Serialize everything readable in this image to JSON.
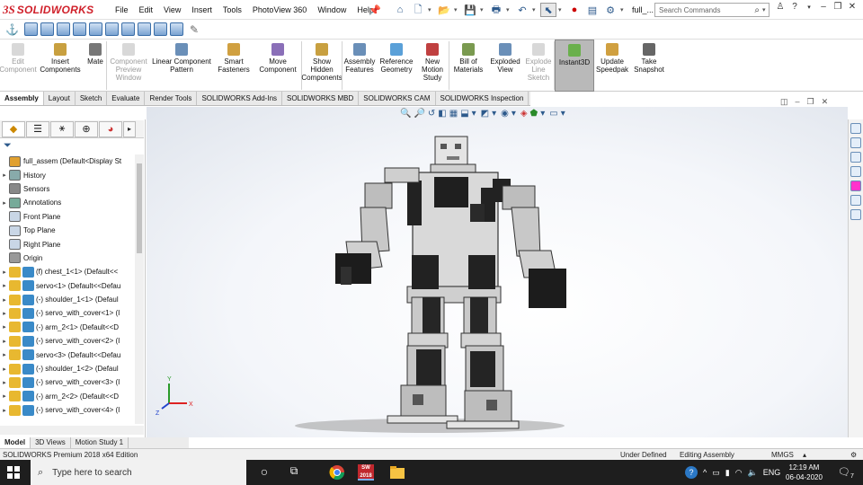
{
  "app": {
    "logo_ds": "3S",
    "logo_text": "SOLIDWORKS",
    "menu": [
      "File",
      "Edit",
      "View",
      "Insert",
      "Tools",
      "PhotoView 360",
      "Window",
      "Help"
    ],
    "doc_name": "full_...",
    "search_placeholder": "Search Commands",
    "help_glyph": "?"
  },
  "command_manager": [
    {
      "label": "Edit Component",
      "icon": "edit-component-icon",
      "enabled": false,
      "active": false
    },
    {
      "label": "Insert Components",
      "icon": "insert-components-icon",
      "enabled": true,
      "active": false
    },
    {
      "label": "Mate",
      "icon": "mate-icon",
      "enabled": true,
      "active": false
    },
    {
      "label": "Component Preview Window",
      "icon": "component-preview-icon",
      "enabled": false,
      "active": false
    },
    {
      "label": "Linear Component Pattern",
      "icon": "linear-pattern-icon",
      "enabled": true,
      "active": false
    },
    {
      "label": "Smart Fasteners",
      "icon": "smart-fasteners-icon",
      "enabled": true,
      "active": false
    },
    {
      "label": "Move Component",
      "icon": "move-component-icon",
      "enabled": true,
      "active": false
    },
    {
      "label": "Show Hidden Components",
      "icon": "show-hidden-icon",
      "enabled": true,
      "active": false
    },
    {
      "label": "Assembly Features",
      "icon": "assembly-features-icon",
      "enabled": true,
      "active": false
    },
    {
      "label": "Reference Geometry",
      "icon": "reference-geometry-icon",
      "enabled": true,
      "active": false
    },
    {
      "label": "New Motion Study",
      "icon": "motion-study-icon",
      "enabled": true,
      "active": false
    },
    {
      "label": "Bill of Materials",
      "icon": "bom-icon",
      "enabled": true,
      "active": false
    },
    {
      "label": "Exploded View",
      "icon": "exploded-view-icon",
      "enabled": true,
      "active": false
    },
    {
      "label": "Explode Line Sketch",
      "icon": "explode-line-icon",
      "enabled": false,
      "active": false
    },
    {
      "label": "Instant3D",
      "icon": "instant3d-icon",
      "enabled": true,
      "active": true
    },
    {
      "label": "Update Speedpak",
      "icon": "speedpak-icon",
      "enabled": true,
      "active": false
    },
    {
      "label": "Take Snapshot",
      "icon": "snapshot-icon",
      "enabled": true,
      "active": false
    }
  ],
  "tabs": [
    "Assembly",
    "Layout",
    "Sketch",
    "Evaluate",
    "Render Tools",
    "SOLIDWORKS Add-Ins",
    "SOLIDWORKS MBD",
    "SOLIDWORKS CAM",
    "SOLIDWORKS Inspection"
  ],
  "active_tab": "Assembly",
  "tree": [
    {
      "label": "full_assem  (Default<Display St",
      "icon": "assembly-icon",
      "arrow": ""
    },
    {
      "label": "History",
      "icon": "history-icon",
      "arrow": "▸"
    },
    {
      "label": "Sensors",
      "icon": "sensors-icon",
      "arrow": ""
    },
    {
      "label": "Annotations",
      "icon": "annotations-icon",
      "arrow": "▸"
    },
    {
      "label": "Front Plane",
      "icon": "plane-icon",
      "arrow": ""
    },
    {
      "label": "Top Plane",
      "icon": "plane-icon",
      "arrow": ""
    },
    {
      "label": "Right Plane",
      "icon": "plane-icon",
      "arrow": ""
    },
    {
      "label": "Origin",
      "icon": "origin-icon",
      "arrow": ""
    },
    {
      "label": "(f) chest_1<1> (Default<<",
      "icon": "part-icon",
      "arrow": "▸"
    },
    {
      "label": "servo<1> (Default<<Defau",
      "icon": "part-icon",
      "arrow": "▸"
    },
    {
      "label": "(-) shoulder_1<1> (Defaul",
      "icon": "part-icon",
      "arrow": "▸"
    },
    {
      "label": "(-) servo_with_cover<1> (I",
      "icon": "part-icon",
      "arrow": "▸"
    },
    {
      "label": "(-) arm_2<1> (Default<<D",
      "icon": "part-icon",
      "arrow": "▸"
    },
    {
      "label": "(-) servo_with_cover<2> (I",
      "icon": "part-icon",
      "arrow": "▸"
    },
    {
      "label": "servo<3> (Default<<Defau",
      "icon": "part-icon",
      "arrow": "▸"
    },
    {
      "label": "(-) shoulder_1<2> (Defaul",
      "icon": "part-icon",
      "arrow": "▸"
    },
    {
      "label": "(-) servo_with_cover<3> (I",
      "icon": "part-icon",
      "arrow": "▸"
    },
    {
      "label": "(-) arm_2<2> (Default<<D",
      "icon": "part-icon",
      "arrow": "▸"
    },
    {
      "label": "(-) servo_with_cover<4> (I",
      "icon": "part-icon",
      "arrow": "▸"
    }
  ],
  "bottom_tabs": [
    "Model",
    "3D Views",
    "Motion Study 1"
  ],
  "status": {
    "edition": "SOLIDWORKS Premium 2018 x64 Edition",
    "defined": "Under Defined",
    "editing": "Editing Assembly",
    "units": "MMGS"
  },
  "taskbar": {
    "search_placeholder": "Type here to search",
    "lang": "ENG",
    "time": "12:19 AM",
    "date": "06-04-2020",
    "notif_count": "7",
    "sw_badge": "2018"
  },
  "colors": {
    "accent": "#d0202a",
    "active_button": "#b9b9b9",
    "taskbar": "#1e1e1e"
  }
}
